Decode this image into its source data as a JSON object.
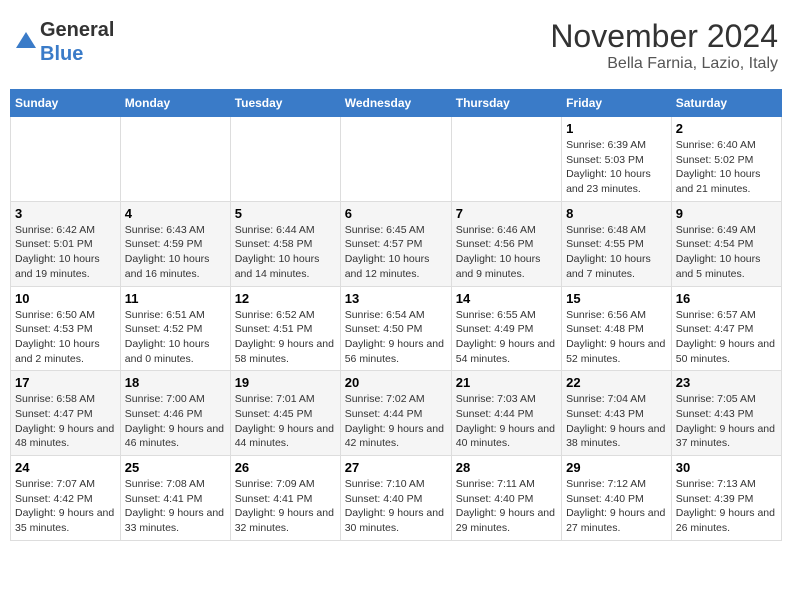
{
  "header": {
    "logo_general": "General",
    "logo_blue": "Blue",
    "month_title": "November 2024",
    "location": "Bella Farnia, Lazio, Italy"
  },
  "days_of_week": [
    "Sunday",
    "Monday",
    "Tuesday",
    "Wednesday",
    "Thursday",
    "Friday",
    "Saturday"
  ],
  "weeks": [
    [
      {
        "day": "",
        "info": ""
      },
      {
        "day": "",
        "info": ""
      },
      {
        "day": "",
        "info": ""
      },
      {
        "day": "",
        "info": ""
      },
      {
        "day": "",
        "info": ""
      },
      {
        "day": "1",
        "info": "Sunrise: 6:39 AM\nSunset: 5:03 PM\nDaylight: 10 hours and 23 minutes."
      },
      {
        "day": "2",
        "info": "Sunrise: 6:40 AM\nSunset: 5:02 PM\nDaylight: 10 hours and 21 minutes."
      }
    ],
    [
      {
        "day": "3",
        "info": "Sunrise: 6:42 AM\nSunset: 5:01 PM\nDaylight: 10 hours and 19 minutes."
      },
      {
        "day": "4",
        "info": "Sunrise: 6:43 AM\nSunset: 4:59 PM\nDaylight: 10 hours and 16 minutes."
      },
      {
        "day": "5",
        "info": "Sunrise: 6:44 AM\nSunset: 4:58 PM\nDaylight: 10 hours and 14 minutes."
      },
      {
        "day": "6",
        "info": "Sunrise: 6:45 AM\nSunset: 4:57 PM\nDaylight: 10 hours and 12 minutes."
      },
      {
        "day": "7",
        "info": "Sunrise: 6:46 AM\nSunset: 4:56 PM\nDaylight: 10 hours and 9 minutes."
      },
      {
        "day": "8",
        "info": "Sunrise: 6:48 AM\nSunset: 4:55 PM\nDaylight: 10 hours and 7 minutes."
      },
      {
        "day": "9",
        "info": "Sunrise: 6:49 AM\nSunset: 4:54 PM\nDaylight: 10 hours and 5 minutes."
      }
    ],
    [
      {
        "day": "10",
        "info": "Sunrise: 6:50 AM\nSunset: 4:53 PM\nDaylight: 10 hours and 2 minutes."
      },
      {
        "day": "11",
        "info": "Sunrise: 6:51 AM\nSunset: 4:52 PM\nDaylight: 10 hours and 0 minutes."
      },
      {
        "day": "12",
        "info": "Sunrise: 6:52 AM\nSunset: 4:51 PM\nDaylight: 9 hours and 58 minutes."
      },
      {
        "day": "13",
        "info": "Sunrise: 6:54 AM\nSunset: 4:50 PM\nDaylight: 9 hours and 56 minutes."
      },
      {
        "day": "14",
        "info": "Sunrise: 6:55 AM\nSunset: 4:49 PM\nDaylight: 9 hours and 54 minutes."
      },
      {
        "day": "15",
        "info": "Sunrise: 6:56 AM\nSunset: 4:48 PM\nDaylight: 9 hours and 52 minutes."
      },
      {
        "day": "16",
        "info": "Sunrise: 6:57 AM\nSunset: 4:47 PM\nDaylight: 9 hours and 50 minutes."
      }
    ],
    [
      {
        "day": "17",
        "info": "Sunrise: 6:58 AM\nSunset: 4:47 PM\nDaylight: 9 hours and 48 minutes."
      },
      {
        "day": "18",
        "info": "Sunrise: 7:00 AM\nSunset: 4:46 PM\nDaylight: 9 hours and 46 minutes."
      },
      {
        "day": "19",
        "info": "Sunrise: 7:01 AM\nSunset: 4:45 PM\nDaylight: 9 hours and 44 minutes."
      },
      {
        "day": "20",
        "info": "Sunrise: 7:02 AM\nSunset: 4:44 PM\nDaylight: 9 hours and 42 minutes."
      },
      {
        "day": "21",
        "info": "Sunrise: 7:03 AM\nSunset: 4:44 PM\nDaylight: 9 hours and 40 minutes."
      },
      {
        "day": "22",
        "info": "Sunrise: 7:04 AM\nSunset: 4:43 PM\nDaylight: 9 hours and 38 minutes."
      },
      {
        "day": "23",
        "info": "Sunrise: 7:05 AM\nSunset: 4:43 PM\nDaylight: 9 hours and 37 minutes."
      }
    ],
    [
      {
        "day": "24",
        "info": "Sunrise: 7:07 AM\nSunset: 4:42 PM\nDaylight: 9 hours and 35 minutes."
      },
      {
        "day": "25",
        "info": "Sunrise: 7:08 AM\nSunset: 4:41 PM\nDaylight: 9 hours and 33 minutes."
      },
      {
        "day": "26",
        "info": "Sunrise: 7:09 AM\nSunset: 4:41 PM\nDaylight: 9 hours and 32 minutes."
      },
      {
        "day": "27",
        "info": "Sunrise: 7:10 AM\nSunset: 4:40 PM\nDaylight: 9 hours and 30 minutes."
      },
      {
        "day": "28",
        "info": "Sunrise: 7:11 AM\nSunset: 4:40 PM\nDaylight: 9 hours and 29 minutes."
      },
      {
        "day": "29",
        "info": "Sunrise: 7:12 AM\nSunset: 4:40 PM\nDaylight: 9 hours and 27 minutes."
      },
      {
        "day": "30",
        "info": "Sunrise: 7:13 AM\nSunset: 4:39 PM\nDaylight: 9 hours and 26 minutes."
      }
    ]
  ]
}
